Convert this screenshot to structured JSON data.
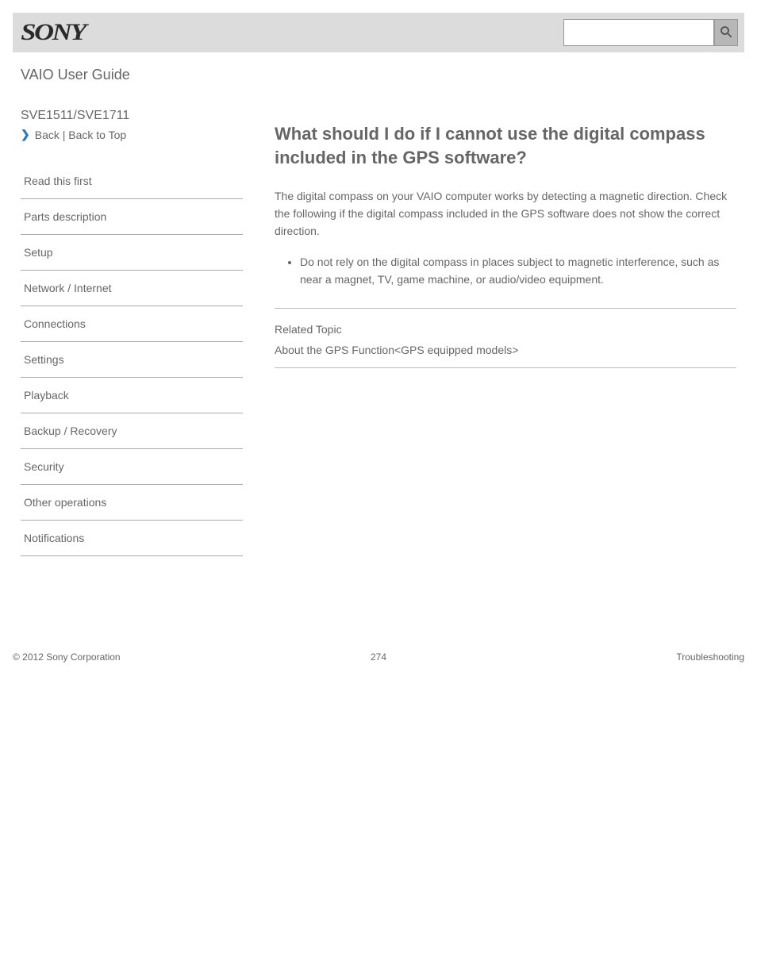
{
  "header": {
    "logo_text": "SONY",
    "search_placeholder": ""
  },
  "sidebar": {
    "brand": "VAIO User Guide",
    "product": "SVE1511/SVE1711",
    "breadcrumb_icon": "chevron-right",
    "breadcrumb": "Back | Back to Top",
    "items": [
      {
        "label": "Read this first"
      },
      {
        "label": "Parts description"
      },
      {
        "label": "Setup"
      },
      {
        "label": "Network / Internet"
      },
      {
        "label": "Connections"
      },
      {
        "label": "Settings"
      },
      {
        "label": "Playback"
      },
      {
        "label": "Backup / Recovery"
      },
      {
        "label": "Security"
      },
      {
        "label": "Other operations"
      },
      {
        "label": "Notifications"
      }
    ]
  },
  "article": {
    "title": "What should I do if I cannot use the digital compass included in the GPS software?",
    "lead": "The digital compass on your VAIO computer works by detecting a magnetic direction. Check the following if the digital compass included in the GPS software does not show the correct direction.",
    "bullets": [
      "Do not rely on the digital compass in places subject to magnetic interference, such as near a magnet, TV, game machine, or audio/video equipment."
    ],
    "related_heading": "Related Topic",
    "related_links": [
      "About the GPS Function<GPS equipped models>"
    ]
  },
  "footer": {
    "copyright": "© 2012 Sony Corporation",
    "page_number": "274",
    "notice": "Troubleshooting"
  }
}
